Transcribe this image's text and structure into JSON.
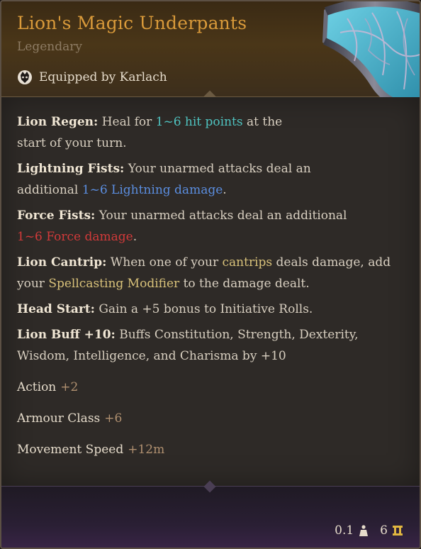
{
  "item": {
    "name": "Lion's Magic Underpants",
    "rarity": "Legendary",
    "equipped": "Equipped by Karlach"
  },
  "colors": {
    "title": "#d99a3a",
    "teal": "#4fc3c0",
    "blue": "#5b8ee0",
    "red": "#d23a3a",
    "gold": "#d9c27a"
  },
  "properties": {
    "lion_regen": {
      "label": "Lion Regen:",
      "text1": " Heal for ",
      "hl": "1~6 hit points",
      "text2": " at the start of your turn."
    },
    "lightning_fists": {
      "label": "Lightning Fists:",
      "text1": " Your unarmed attacks deal an additional ",
      "hl": "1~6 Lightning damage",
      "text2": "."
    },
    "force_fists": {
      "label": "Force Fists:",
      "text1": " Your unarmed attacks deal an additional ",
      "hl": "1~6 Force damage",
      "text2": "."
    },
    "lion_cantrip": {
      "label": "Lion Cantrip:",
      "text1": " When one of your ",
      "hl1": "cantrips",
      "text2": " deals damage, add your ",
      "hl2": "Spellcasting Modifier",
      "text3": " to the damage dealt."
    },
    "head_start": {
      "label": "Head Start:",
      "text": " Gain a +5 bonus to Initiative Rolls."
    },
    "lion_buff": {
      "label": "Lion Buff +10:",
      "text": " Buffs Constitution, Strength, Dexterity, Wisdom, Intelligence, and Charisma by +10"
    }
  },
  "stats": [
    {
      "label": "Action",
      "value": "+2"
    },
    {
      "label": "Armour Class",
      "value": "+6"
    },
    {
      "label": "Movement Speed",
      "value": "+12m"
    }
  ],
  "footer": {
    "weight": "0.1",
    "weight_icon": "weight-icon",
    "value": "6",
    "value_icon": "gold-coins-icon"
  }
}
